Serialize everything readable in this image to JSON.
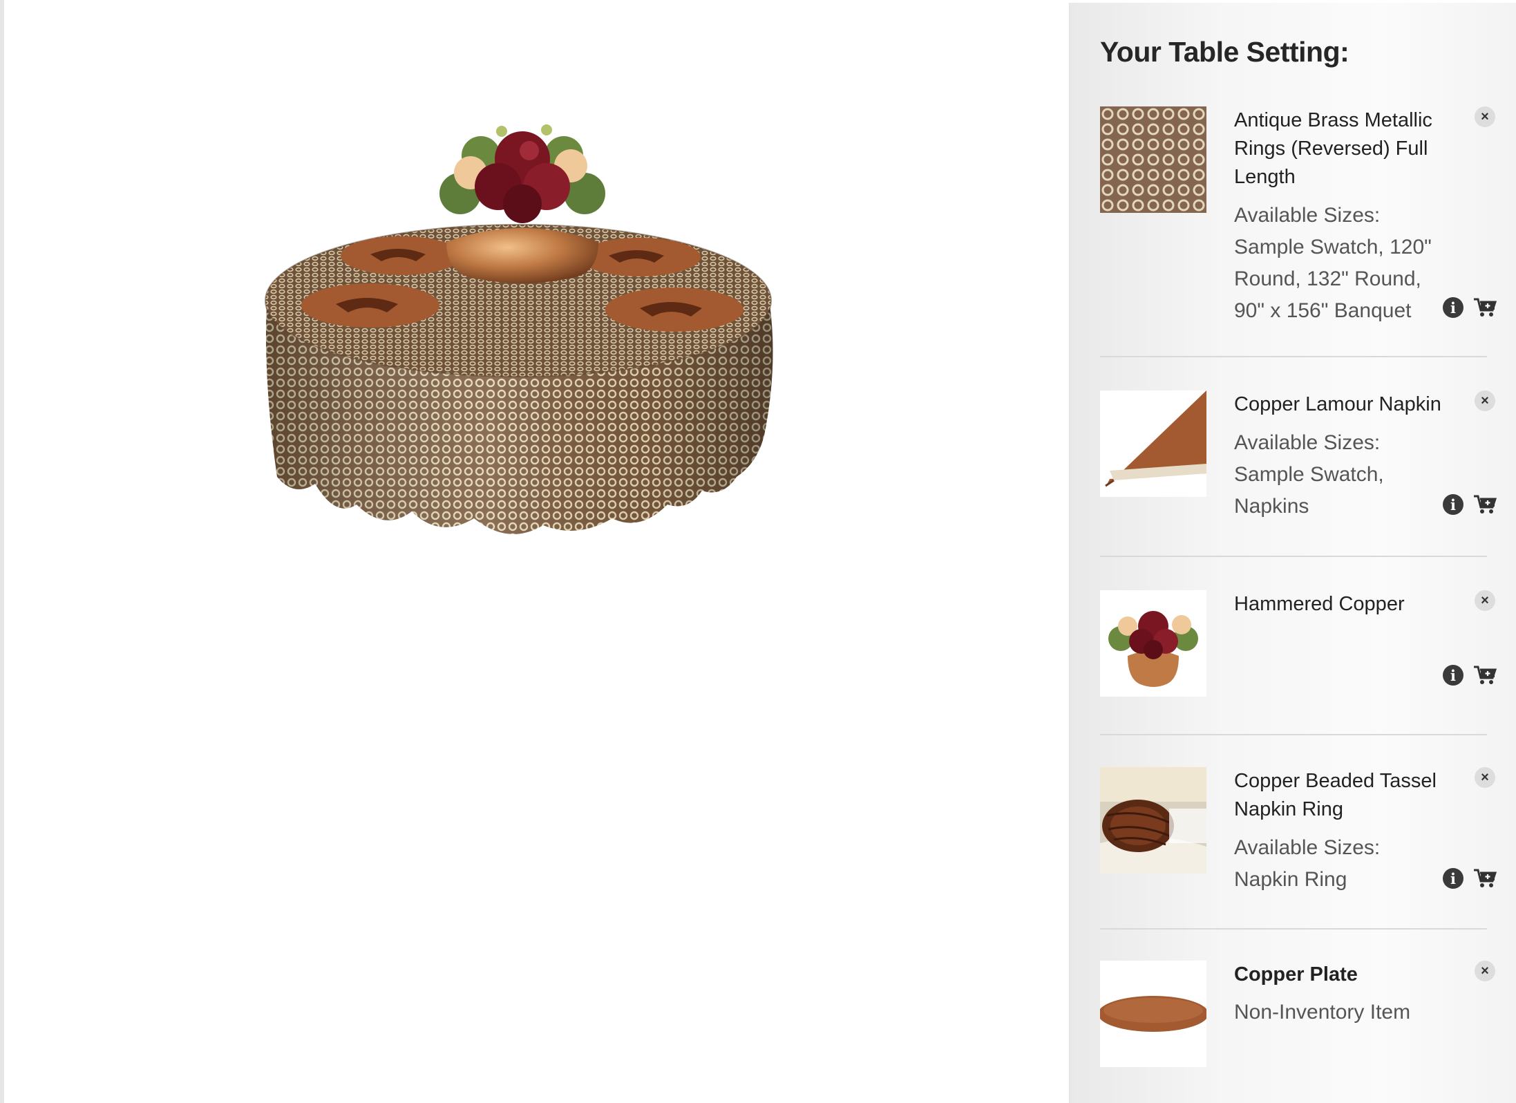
{
  "panel": {
    "title": "Your Table Setting:",
    "items": [
      {
        "name": "Antique Brass Metallic Rings (Reversed) Full Length",
        "sizes_label": "Available Sizes:",
        "sizes": "Sample Swatch, 120\" Round, 132\" Round, 90\" x 156\" Banquet",
        "thumb_icon": "tablecloth-swatch-image"
      },
      {
        "name": "Copper Lamour Napkin",
        "sizes_label": "Available Sizes:",
        "sizes": "Sample Swatch, Napkins",
        "thumb_icon": "napkin-image"
      },
      {
        "name": "Hammered Copper",
        "thumb_icon": "centerpiece-image"
      },
      {
        "name": "Copper Beaded Tassel Napkin Ring",
        "sizes_label": "Available Sizes:",
        "sizes": "Napkin Ring",
        "thumb_icon": "napkin-ring-image"
      },
      {
        "name": "Copper Plate",
        "note": "Non-Inventory Item",
        "thumb_icon": "plate-image"
      }
    ],
    "icons": {
      "close": "×",
      "info": "i",
      "cart": "add-to-cart-icon"
    }
  },
  "colors": {
    "copper": "#a35a31",
    "tablecloth_base": "#8a6a4a",
    "ring_light": "#e8d9b8",
    "flower_red": "#7a1522",
    "panel_bg": "#f4f4f4"
  }
}
